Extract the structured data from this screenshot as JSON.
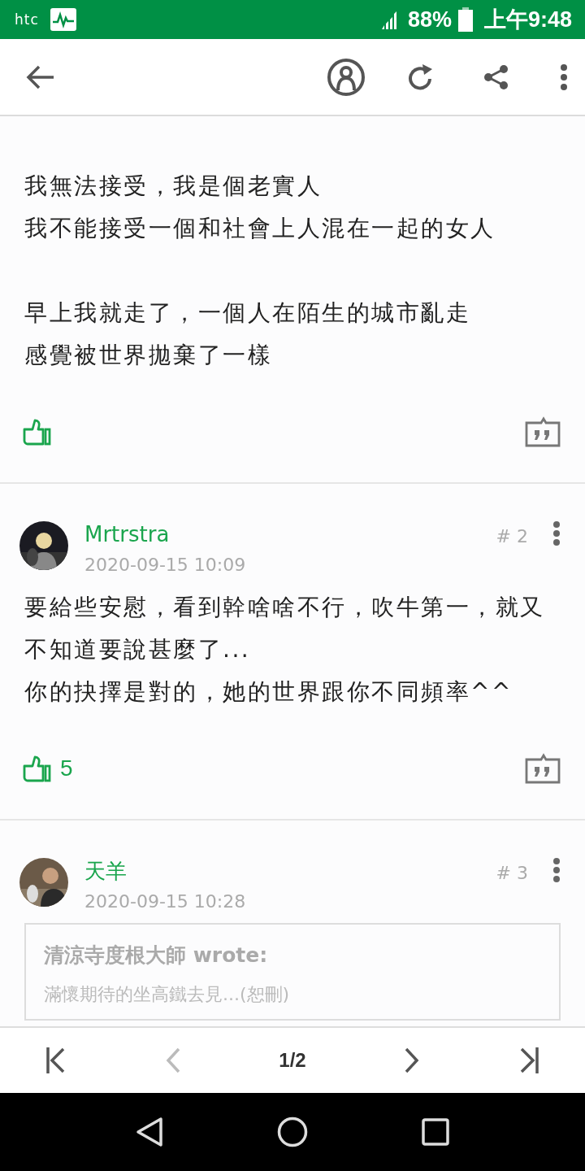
{
  "status_bar": {
    "brand": "htc",
    "battery": "88%",
    "time": "上午9:48"
  },
  "posts": [
    {
      "paragraphs": [
        [
          "我無法接受，我是個老實人",
          "我不能接受一個和社會上人混在一起的女人"
        ],
        [
          "早上我就走了，一個人在陌生的城市亂走",
          "感覺被世界拋棄了一樣"
        ]
      ]
    },
    {
      "author": "Mrtrstra",
      "date": "2020-09-15 10:09",
      "floor": "# 2",
      "paragraphs": [
        [
          "要給些安慰，看到幹啥啥不行，吹牛第一，就又不知道要說甚麼了...",
          "你的抉擇是對的，她的世界跟你不同頻率^^"
        ]
      ],
      "likes": "5"
    },
    {
      "author": "天羊",
      "date": "2020-09-15 10:28",
      "floor": "# 3",
      "quote": {
        "title": "清涼寺度根大師 wrote:",
        "text": "滿懷期待的坐高鐵去見...(恕刪)"
      }
    }
  ],
  "pager": {
    "page": "1/2",
    "prev_disabled": true
  }
}
